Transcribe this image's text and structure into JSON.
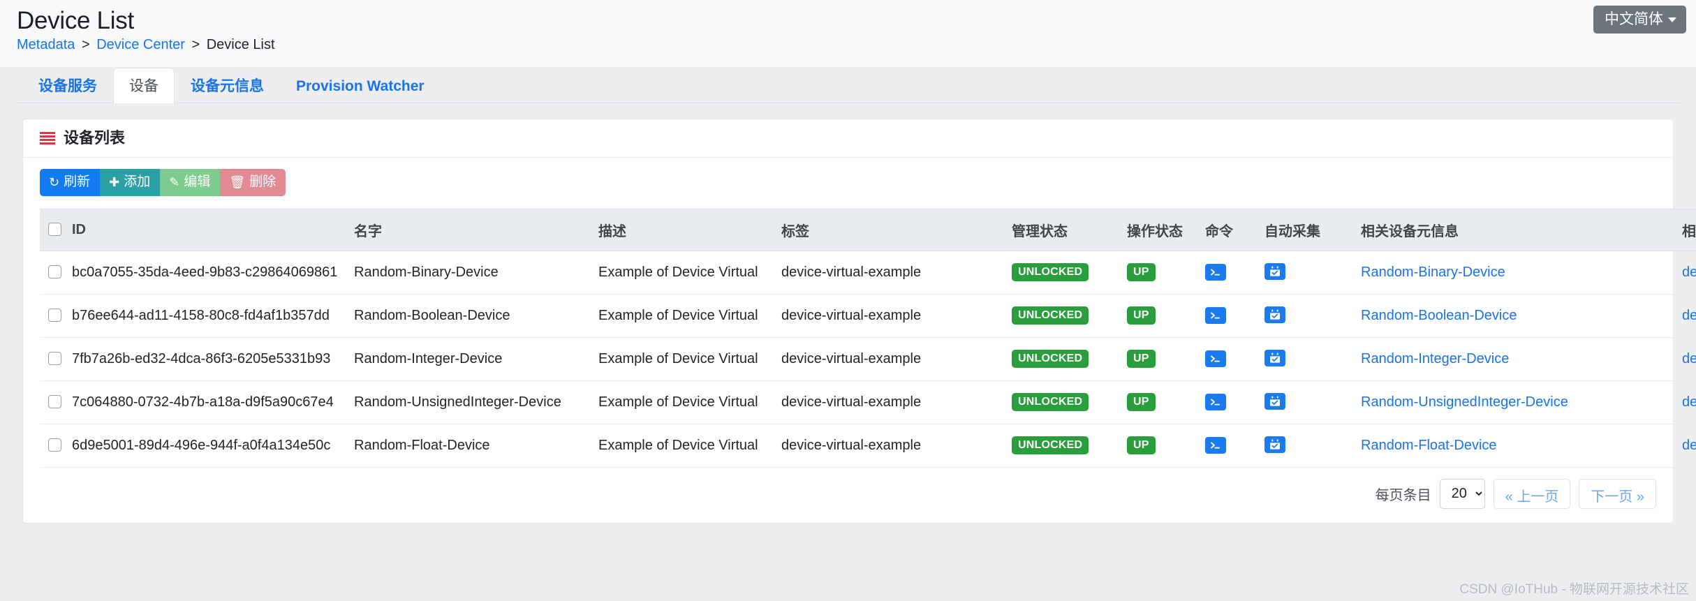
{
  "header": {
    "title": "Device List",
    "breadcrumb": [
      {
        "label": "Metadata",
        "link": true
      },
      {
        "label": "Device Center",
        "link": true
      },
      {
        "label": "Device List",
        "link": false
      }
    ],
    "separator": ">",
    "language_button": "中文简体"
  },
  "tabs": [
    {
      "label": "设备服务",
      "active": false
    },
    {
      "label": "设备",
      "active": true
    },
    {
      "label": "设备元信息",
      "active": false
    },
    {
      "label": "Provision Watcher",
      "active": false
    }
  ],
  "card": {
    "title": "设备列表",
    "title_icon": "list-icon"
  },
  "toolbar": {
    "refresh": {
      "label": "刷新",
      "icon": "refresh-icon",
      "color": "#117bf3"
    },
    "add": {
      "label": "添加",
      "icon": "plus-icon",
      "color": "#2aa0a4"
    },
    "edit": {
      "label": "编辑",
      "icon": "edit-icon",
      "color": "#7ecb8e"
    },
    "delete": {
      "label": "删除",
      "icon": "trash-icon",
      "color": "#e38b95"
    }
  },
  "table": {
    "columns": [
      "",
      "ID",
      "名字",
      "描述",
      "标签",
      "管理状态",
      "操作状态",
      "命令",
      "自动采集",
      "相关设备元信息",
      "相关设备服务"
    ],
    "rows": [
      {
        "id": "bc0a7055-35da-4eed-9b83-c29864069861",
        "name": "Random-Binary-Device",
        "description": "Example of Device Virtual",
        "labels": "device-virtual-example",
        "admin_state": "UNLOCKED",
        "operating_state": "UP",
        "command_icon": "terminal-icon",
        "auto_collect_icon": "calendar-check-icon",
        "profile": "Random-Binary-Device",
        "service": "device-virtual"
      },
      {
        "id": "b76ee644-ad11-4158-80c8-fd4af1b357dd",
        "name": "Random-Boolean-Device",
        "description": "Example of Device Virtual",
        "labels": "device-virtual-example",
        "admin_state": "UNLOCKED",
        "operating_state": "UP",
        "command_icon": "terminal-icon",
        "auto_collect_icon": "calendar-check-icon",
        "profile": "Random-Boolean-Device",
        "service": "device-virtual"
      },
      {
        "id": "7fb7a26b-ed32-4dca-86f3-6205e5331b93",
        "name": "Random-Integer-Device",
        "description": "Example of Device Virtual",
        "labels": "device-virtual-example",
        "admin_state": "UNLOCKED",
        "operating_state": "UP",
        "command_icon": "terminal-icon",
        "auto_collect_icon": "calendar-check-icon",
        "profile": "Random-Integer-Device",
        "service": "device-virtual"
      },
      {
        "id": "7c064880-0732-4b7b-a18a-d9f5a90c67e4",
        "name": "Random-UnsignedInteger-Device",
        "description": "Example of Device Virtual",
        "labels": "device-virtual-example",
        "admin_state": "UNLOCKED",
        "operating_state": "UP",
        "command_icon": "terminal-icon",
        "auto_collect_icon": "calendar-check-icon",
        "profile": "Random-UnsignedInteger-Device",
        "service": "device-virtual"
      },
      {
        "id": "6d9e5001-89d4-496e-944f-a0f4a134e50c",
        "name": "Random-Float-Device",
        "description": "Example of Device Virtual",
        "labels": "device-virtual-example",
        "admin_state": "UNLOCKED",
        "operating_state": "UP",
        "command_icon": "terminal-icon",
        "auto_collect_icon": "calendar-check-icon",
        "profile": "Random-Float-Device",
        "service": "device-virtual"
      }
    ]
  },
  "pagination": {
    "label": "每页条目",
    "page_size": "20",
    "page_size_options": [
      "20"
    ],
    "prev": "« 上一页",
    "next": "下一页 »"
  },
  "watermark": "CSDN @IoTHub - 物联网开源技术社区",
  "colors": {
    "link": "#1a73e8",
    "badge_green": "#2a9d3c",
    "command_blue": "#1a7bf0",
    "accent_red": "#dc3545"
  }
}
